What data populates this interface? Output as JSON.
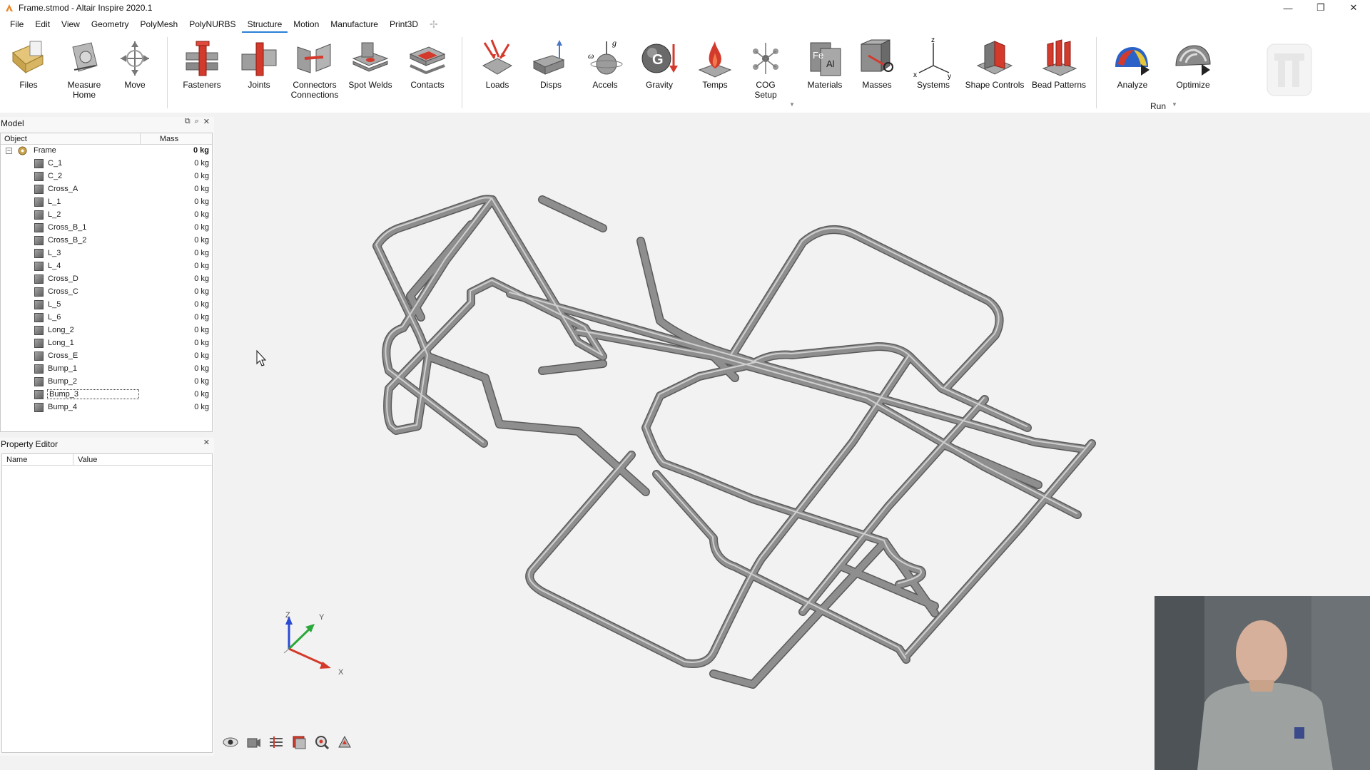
{
  "window": {
    "title": "Frame.stmod - Altair Inspire 2020.1",
    "controls": [
      "—",
      "❐",
      "✕"
    ]
  },
  "menu": [
    "File",
    "Edit",
    "View",
    "Geometry",
    "PolyMesh",
    "PolyNURBS",
    "Structure",
    "Motion",
    "Manufacture",
    "Print3D"
  ],
  "menu_active": "Structure",
  "ribbon": {
    "files": "Files",
    "measure": [
      "Measure",
      "Home"
    ],
    "move": "Move",
    "fasteners": "Fasteners",
    "joints": "Joints",
    "connectors": [
      "Connectors",
      "Connections"
    ],
    "spot_welds": "Spot Welds",
    "contacts": "Contacts",
    "loads": "Loads",
    "disps": "Disps",
    "accels": "Accels",
    "gravity": "Gravity",
    "temps": "Temps",
    "cog": [
      "COG",
      "Setup"
    ],
    "materials": "Materials",
    "masses": "Masses",
    "systems": "Systems",
    "shape_controls": "Shape Controls",
    "bead_patterns": "Bead Patterns",
    "analyze": "Analyze",
    "optimize": "Optimize",
    "run": "Run"
  },
  "model_panel": {
    "title": "Model",
    "col_object": "Object",
    "col_mass": "Mass",
    "root": {
      "name": "Frame",
      "mass": "0 kg"
    },
    "parts": [
      {
        "name": "C_1",
        "mass": "0 kg"
      },
      {
        "name": "C_2",
        "mass": "0 kg"
      },
      {
        "name": "Cross_A",
        "mass": "0 kg"
      },
      {
        "name": "L_1",
        "mass": "0 kg"
      },
      {
        "name": "L_2",
        "mass": "0 kg"
      },
      {
        "name": "Cross_B_1",
        "mass": "0 kg"
      },
      {
        "name": "Cross_B_2",
        "mass": "0 kg"
      },
      {
        "name": "L_3",
        "mass": "0 kg"
      },
      {
        "name": "L_4",
        "mass": "0 kg"
      },
      {
        "name": "Cross_D",
        "mass": "0 kg"
      },
      {
        "name": "Cross_C",
        "mass": "0 kg"
      },
      {
        "name": "L_5",
        "mass": "0 kg"
      },
      {
        "name": "L_6",
        "mass": "0 kg"
      },
      {
        "name": "Long_2",
        "mass": "0 kg"
      },
      {
        "name": "Long_1",
        "mass": "0 kg"
      },
      {
        "name": "Cross_E",
        "mass": "0 kg"
      },
      {
        "name": "Bump_1",
        "mass": "0 kg"
      },
      {
        "name": "Bump_2",
        "mass": "0 kg"
      },
      {
        "name": "Bump_3",
        "mass": "0 kg"
      },
      {
        "name": "Bump_4",
        "mass": "0 kg"
      }
    ],
    "selected": "Bump_3"
  },
  "property_editor": {
    "title": "Property Editor",
    "col_name": "Name",
    "col_value": "Value"
  },
  "axis_labels": {
    "x": "X",
    "y": "Y",
    "z": "Z"
  },
  "colors": {
    "accent": "#2a7fd4",
    "tube": "#8a8a8a",
    "viewport_bg": "#f2f2f2"
  }
}
